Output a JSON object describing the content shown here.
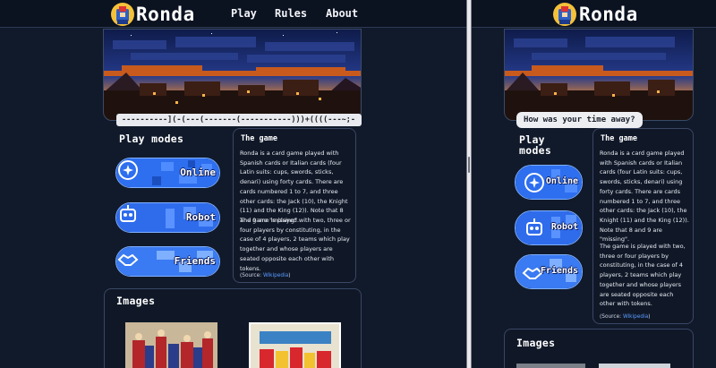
{
  "brand": {
    "name": "Ronda"
  },
  "nav": {
    "play": "Play",
    "rules": "Rules",
    "about": "About"
  },
  "left": {
    "status_text": "----------](-(---(-------(-----------)))+((((---~;-"
  },
  "right": {
    "bubble_text": "How was your time away?"
  },
  "play_modes": {
    "title": "Play modes",
    "online": "Online",
    "robot": "Robot",
    "friends": "Friends"
  },
  "game": {
    "title": "The game",
    "p1": "Ronda is a card game played with Spanish cards or Italian cards (four Latin suits: cups, swords, sticks, denari) using forty cards. There are cards numbered 1 to 7, and three other cards: the Jack (10), the Knight (11) and the King (12)). Note that 8 and 9 are \"missing\".",
    "p2": "The game is played with two, three or four players by constituting, in the case of 4 players, 2 teams which play together and whose players are seated opposite each other with tokens.",
    "source_prefix": "(Source: ",
    "source_link": "Wikipedia",
    "source_suffix": ")"
  },
  "images": {
    "title": "Images"
  },
  "colors": {
    "background": "#111a2b",
    "nav": "#0b1220",
    "accent": "#5b9bff",
    "button_blue": "#2f6bff",
    "card_border": "#3a4764"
  },
  "icons": {
    "logo": "lion-knight-logo",
    "online": "globe-sparkle-icon",
    "robot": "robot-face-icon",
    "friends": "handshake-icon"
  }
}
